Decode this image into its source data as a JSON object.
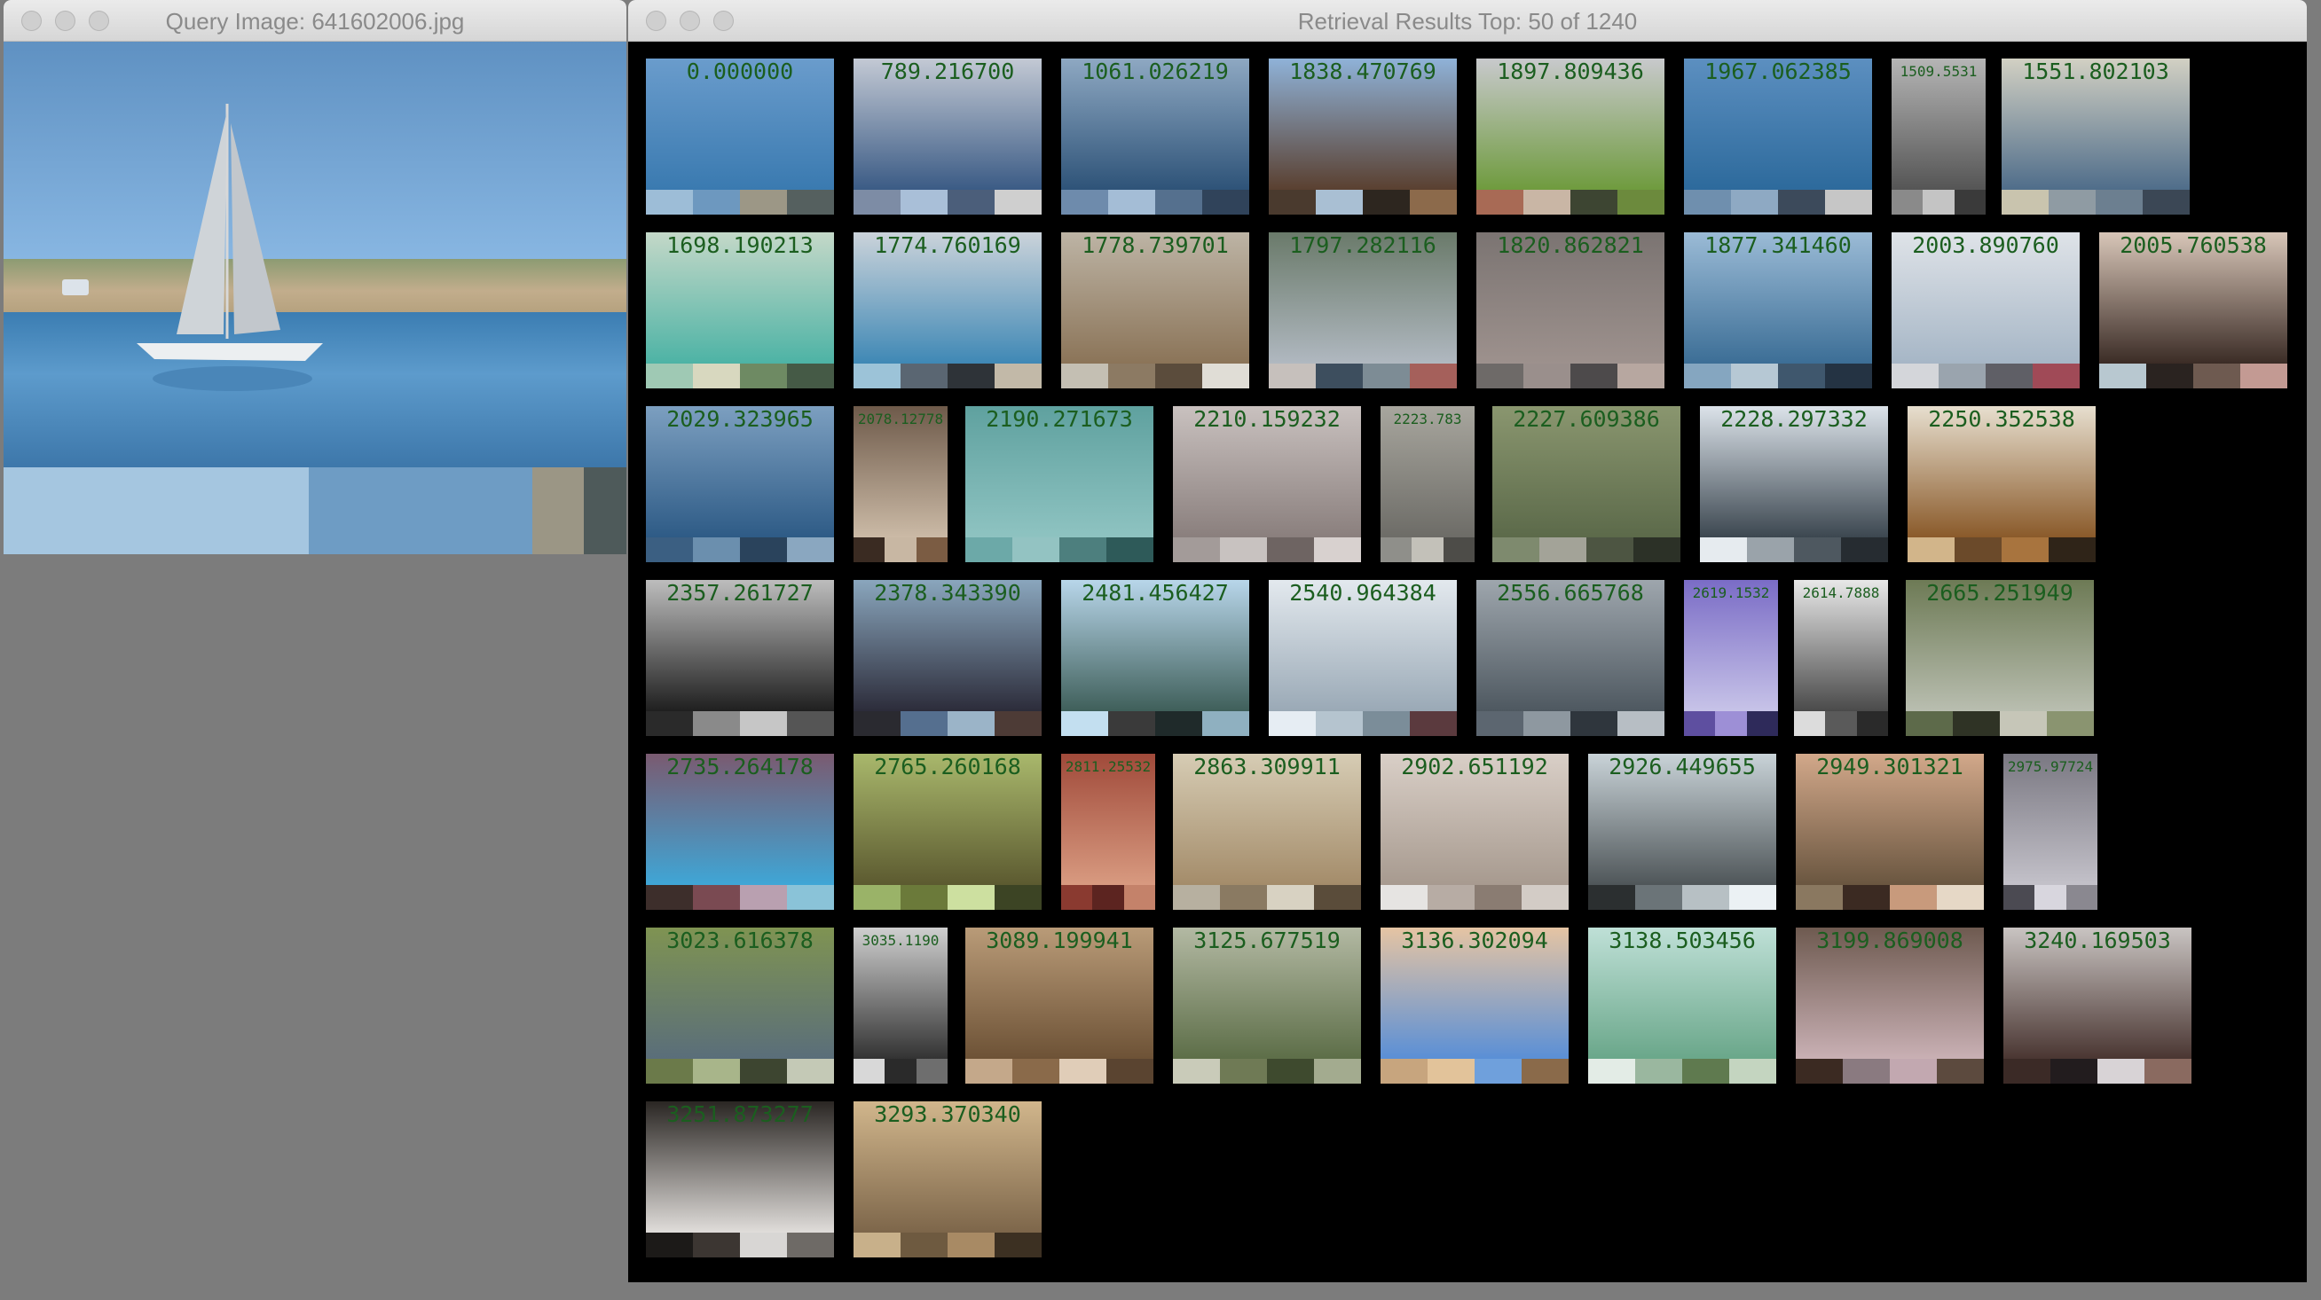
{
  "query_window": {
    "title": "Query Image: 641602006.jpg",
    "palette": [
      "#a5c6e0",
      "#6e9cc4",
      "#9b9685",
      "#4e5a5a"
    ]
  },
  "results_window": {
    "title": "Retrieval Results Top: 50 of 1240",
    "results": [
      {
        "dist": "0.000000",
        "palette": [
          "#9dbdd7",
          "#6d98bf",
          "#9c9786",
          "#55605f"
        ],
        "colors": [
          "#6a9ccc",
          "#3a7ab0"
        ]
      },
      {
        "dist": "789.216700",
        "palette": [
          "#7d8ca5",
          "#a9bfd8",
          "#4b5e7a",
          "#cfcfcf"
        ],
        "colors": [
          "#c3c9d4",
          "#3b5b85"
        ]
      },
      {
        "dist": "1061.026219",
        "palette": [
          "#6e8bac",
          "#a4bdd6",
          "#55708e",
          "#30435a"
        ],
        "colors": [
          "#8ea8c2",
          "#2e5378"
        ]
      },
      {
        "dist": "1838.470769",
        "palette": [
          "#4a3a2e",
          "#a9bfd3",
          "#2d261f",
          "#8c6a4b"
        ],
        "colors": [
          "#8fb2d8",
          "#5a4030"
        ]
      },
      {
        "dist": "1897.809436",
        "palette": [
          "#a86a55",
          "#c9b6a5",
          "#3d4532",
          "#6c8a3d"
        ],
        "colors": [
          "#c8c9cc",
          "#6f9b3e"
        ]
      },
      {
        "dist": "1967.062385",
        "palette": [
          "#6f8fae",
          "#8ea9c3",
          "#3c4a5b",
          "#c6c6c6"
        ],
        "colors": [
          "#5c8fc0",
          "#2d6a9c"
        ]
      },
      {
        "dist": "1509.5531",
        "palette": [
          "#8a8a8a",
          "#c4c4c4",
          "#3a3a3a"
        ],
        "colors": [
          "#b5b5b5",
          "#555555"
        ]
      },
      {
        "dist": "1551.802103",
        "palette": [
          "#c9c4ae",
          "#8f9ba3",
          "#6c7f90",
          "#3b4755"
        ],
        "colors": [
          "#d2d0c3",
          "#4f6d8a"
        ]
      },
      {
        "dist": "1698.190213",
        "palette": [
          "#9fc9b4",
          "#d8d8bf",
          "#6e8a63",
          "#455a46"
        ],
        "colors": [
          "#c4d8c8",
          "#4db3a5"
        ]
      },
      {
        "dist": "1774.760169",
        "palette": [
          "#9cc3d8",
          "#5a6672",
          "#2e3338",
          "#c2b9a8"
        ],
        "colors": [
          "#cbd3da",
          "#3f88b5"
        ]
      },
      {
        "dist": "1778.739701",
        "palette": [
          "#c4bfb3",
          "#8c7a63",
          "#5b4c3c",
          "#e0ddd6"
        ],
        "colors": [
          "#bdb4a5",
          "#8b7458"
        ]
      },
      {
        "dist": "1797.282116",
        "palette": [
          "#c6c0bc",
          "#3d4e5e",
          "#7d8c95",
          "#a5605b"
        ],
        "colors": [
          "#6a7a6a",
          "#b0b8c0"
        ]
      },
      {
        "dist": "1820.862821",
        "palette": [
          "#6e6a68",
          "#9a8f8c",
          "#4d4a4b",
          "#b7a7a0"
        ],
        "colors": [
          "#7b7472",
          "#9d918d"
        ]
      },
      {
        "dist": "1877.341460",
        "palette": [
          "#85a6c0",
          "#b6c8d4",
          "#3f576d",
          "#243343"
        ],
        "colors": [
          "#9bbbd6",
          "#3c6e96"
        ]
      },
      {
        "dist": "2003.890760",
        "palette": [
          "#d4d6da",
          "#9aa4ae",
          "#5f5f66",
          "#a04a57"
        ],
        "colors": [
          "#dfe3e8",
          "#a6b6c6"
        ]
      },
      {
        "dist": "2005.760538",
        "palette": [
          "#b8c8d0",
          "#2a2320",
          "#6e5a50",
          "#c39a93"
        ],
        "colors": [
          "#d8c6b8",
          "#3b2c26"
        ]
      },
      {
        "dist": "2029.323965",
        "palette": [
          "#3b5f82",
          "#6b8fae",
          "#2a435c",
          "#8aa7c0"
        ],
        "colors": [
          "#7c9fc0",
          "#2e5b86"
        ]
      },
      {
        "dist": "2078.12778",
        "palette": [
          "#3a2b22",
          "#c8b7a3",
          "#7b5c43"
        ],
        "colors": [
          "#6e5a4a",
          "#cbbaa6"
        ]
      },
      {
        "dist": "2190.271673",
        "palette": [
          "#6ca9a8",
          "#93c3c2",
          "#4d7f7e",
          "#2e5a59"
        ],
        "colors": [
          "#5fa19f",
          "#8ec3c1"
        ]
      },
      {
        "dist": "2210.159232",
        "palette": [
          "#a39b99",
          "#c8c2c0",
          "#6e6462",
          "#d8d1cf"
        ],
        "colors": [
          "#c9c1bf",
          "#8a7f7d"
        ]
      },
      {
        "dist": "2223.783",
        "palette": [
          "#8f8f8a",
          "#c3c1b9",
          "#4d4c48"
        ],
        "colors": [
          "#a8a69e",
          "#6d6c67"
        ]
      },
      {
        "dist": "2227.609386",
        "palette": [
          "#7e8a6e",
          "#a3a398",
          "#4d5542",
          "#2c3127"
        ],
        "colors": [
          "#8a966f",
          "#5c6a4a"
        ]
      },
      {
        "dist": "2228.297332",
        "palette": [
          "#e6ebef",
          "#9aa3aa",
          "#4e5860",
          "#262c31"
        ],
        "colors": [
          "#dce3ea",
          "#3c4750"
        ]
      },
      {
        "dist": "2250.352538",
        "palette": [
          "#d2b58a",
          "#6b4a2a",
          "#a8743e",
          "#2f2418"
        ],
        "colors": [
          "#e7dfcf",
          "#8a5a2a"
        ]
      },
      {
        "dist": "2357.261727",
        "palette": [
          "#2a2a2a",
          "#8a8a8a",
          "#c6c6c6",
          "#555555"
        ],
        "colors": [
          "#bdbdbd",
          "#1f1f1f"
        ]
      },
      {
        "dist": "2378.343390",
        "palette": [
          "#2a2a30",
          "#556f8f",
          "#9bb4c8",
          "#4d3b36"
        ],
        "colors": [
          "#8aa6bd",
          "#2c2c3a"
        ]
      },
      {
        "dist": "2481.456427",
        "palette": [
          "#c3dff0",
          "#3a3a3a",
          "#1f2a2a",
          "#8fb0c0"
        ],
        "colors": [
          "#b8d6ea",
          "#3f5f5a"
        ]
      },
      {
        "dist": "2540.964384",
        "palette": [
          "#e6edf3",
          "#b5c4cf",
          "#7b8d99",
          "#5b3a3e"
        ],
        "colors": [
          "#e3e9ee",
          "#9aa9b6"
        ]
      },
      {
        "dist": "2556.665768",
        "palette": [
          "#5c6670",
          "#8e98a0",
          "#2f363d",
          "#b7bec4"
        ],
        "colors": [
          "#9ea6ad",
          "#4e5860"
        ]
      },
      {
        "dist": "2619.1532",
        "palette": [
          "#5e4fa0",
          "#9d8fd6",
          "#2e2a5a"
        ],
        "colors": [
          "#7a6cc6",
          "#c7c3e8"
        ]
      },
      {
        "dist": "2614.7888",
        "palette": [
          "#dcdcdc",
          "#5a5a5a",
          "#2a2a2a"
        ],
        "colors": [
          "#e8e8e8",
          "#4a4a4a"
        ]
      },
      {
        "dist": "2665.251949",
        "palette": [
          "#5d6a4a",
          "#2f3325",
          "#c6c6b8",
          "#8a9470"
        ],
        "colors": [
          "#6d7a55",
          "#b9beb0"
        ]
      },
      {
        "dist": "2735.264178",
        "palette": [
          "#3d2e2b",
          "#7a4a52",
          "#b9a0b0",
          "#8ac3d8"
        ],
        "colors": [
          "#7a5a70",
          "#3fa6d6"
        ]
      },
      {
        "dist": "2765.260168",
        "palette": [
          "#9ab368",
          "#6b7a3a",
          "#cde0a0",
          "#3c4424"
        ],
        "colors": [
          "#a9b86c",
          "#5c5a30"
        ]
      },
      {
        "dist": "2811.25532",
        "palette": [
          "#8a3a30",
          "#5c2420",
          "#c4826a"
        ],
        "colors": [
          "#a04a3a",
          "#d89a80"
        ]
      },
      {
        "dist": "2863.309911",
        "palette": [
          "#b7b0a0",
          "#8a7a62",
          "#d8d2c2",
          "#5a4c3a"
        ],
        "colors": [
          "#d6ccb4",
          "#a48c6a"
        ]
      },
      {
        "dist": "2902.651192",
        "palette": [
          "#e6e4e2",
          "#b7aca4",
          "#8a7c72",
          "#d3ccc6"
        ],
        "colors": [
          "#d9cfc7",
          "#a79a8f"
        ]
      },
      {
        "dist": "2926.449655",
        "palette": [
          "#2b2f30",
          "#6b7478",
          "#b7c0c4",
          "#ebf1f4"
        ],
        "colors": [
          "#c9d3d8",
          "#4f5659"
        ]
      },
      {
        "dist": "2949.301321",
        "palette": [
          "#8a7860",
          "#3b2a22",
          "#c89a7c",
          "#e6d8c6"
        ],
        "colors": [
          "#d2a88a",
          "#6a5640"
        ]
      },
      {
        "dist": "2975.97724",
        "palette": [
          "#4b4a52",
          "#d8d6de",
          "#8a8890"
        ],
        "colors": [
          "#7a7882",
          "#c3c1c9"
        ]
      },
      {
        "dist": "3023.616378",
        "palette": [
          "#6b7a4a",
          "#a8b58a",
          "#3d4530",
          "#c4c9b6"
        ],
        "colors": [
          "#7f9352",
          "#5a6e7a"
        ]
      },
      {
        "dist": "3035.1190",
        "palette": [
          "#d8d8d8",
          "#2a2a2a",
          "#6e6e6e"
        ],
        "colors": [
          "#cfcfcf",
          "#333333"
        ]
      },
      {
        "dist": "3089.199941",
        "palette": [
          "#c4a88a",
          "#8a6a4a",
          "#e0cdb8",
          "#5a4430"
        ],
        "colors": [
          "#b99b78",
          "#6d5236"
        ]
      },
      {
        "dist": "3125.677519",
        "palette": [
          "#c9cbb9",
          "#6f7a55",
          "#3e4a2e",
          "#a3ab8f"
        ],
        "colors": [
          "#b3b9a3",
          "#5d6e48"
        ]
      },
      {
        "dist": "3136.302094",
        "palette": [
          "#c7a57e",
          "#e2c39a",
          "#6fa0dc",
          "#8a6a4a"
        ],
        "colors": [
          "#e5c4a3",
          "#5a8fd6"
        ]
      },
      {
        "dist": "3138.503456",
        "palette": [
          "#e3ece6",
          "#9ab79f",
          "#5f7a4f",
          "#c4d5c0"
        ],
        "colors": [
          "#bfe0d7",
          "#6aa78a"
        ]
      },
      {
        "dist": "3199.869008",
        "palette": [
          "#3b2a22",
          "#8a7a80",
          "#c2a8b0",
          "#5c4a3e"
        ],
        "colors": [
          "#6e5a50",
          "#c9b0b4"
        ]
      },
      {
        "dist": "3240.169503",
        "palette": [
          "#3b2a26",
          "#221c1e",
          "#d8d3d6",
          "#8a6a60"
        ],
        "colors": [
          "#c9c4c2",
          "#4a3632"
        ]
      },
      {
        "dist": "3251.873277",
        "palette": [
          "#1c1a18",
          "#3c3632",
          "#d8d6d4",
          "#6e6a66"
        ],
        "colors": [
          "#2a2623",
          "#e0ddda"
        ]
      },
      {
        "dist": "3293.370340",
        "palette": [
          "#c8b08a",
          "#6e5a40",
          "#a88a64",
          "#3c3022"
        ],
        "colors": [
          "#d1b68c",
          "#7d664a"
        ]
      }
    ]
  }
}
